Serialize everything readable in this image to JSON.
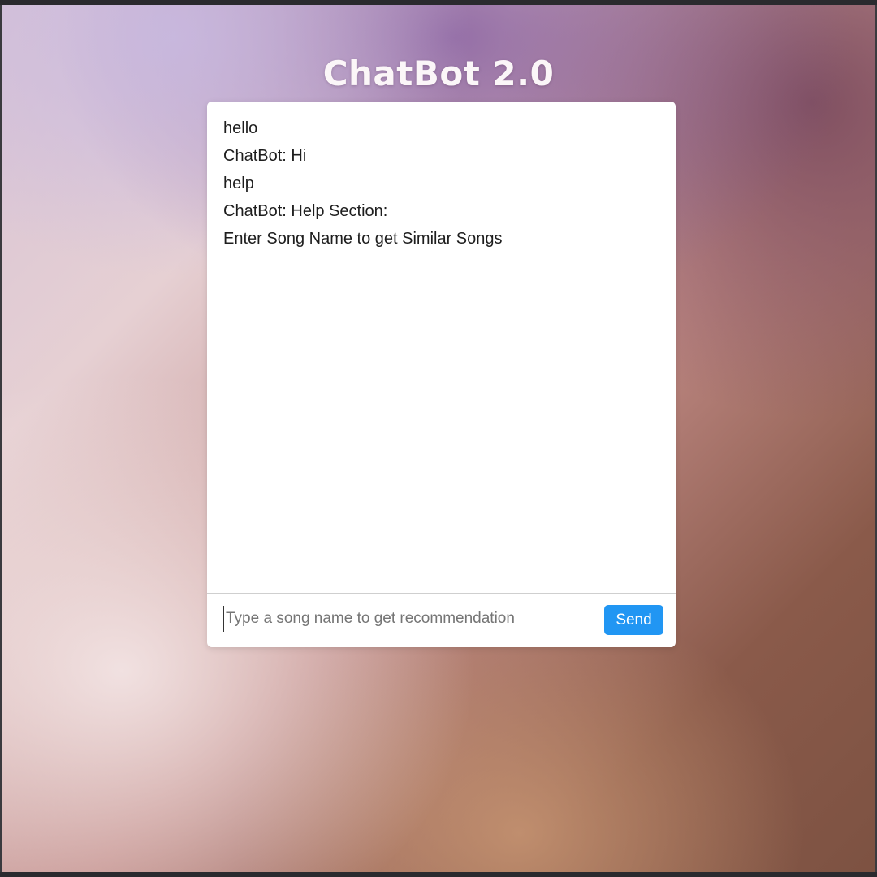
{
  "app": {
    "title": "ChatBot 2.0"
  },
  "chat": {
    "messages": [
      {
        "text": "hello"
      },
      {
        "text": "ChatBot: Hi"
      },
      {
        "text": "help"
      },
      {
        "text": "ChatBot: Help Section:"
      },
      {
        "text": "Enter Song Name to get Similar Songs"
      }
    ]
  },
  "input": {
    "value": "",
    "placeholder": "Type a song name to get recommendation"
  },
  "send_button": {
    "label": "Send"
  },
  "colors": {
    "accent": "#2196f3",
    "card_background": "#ffffff",
    "title_text": "#fbf6f8"
  }
}
